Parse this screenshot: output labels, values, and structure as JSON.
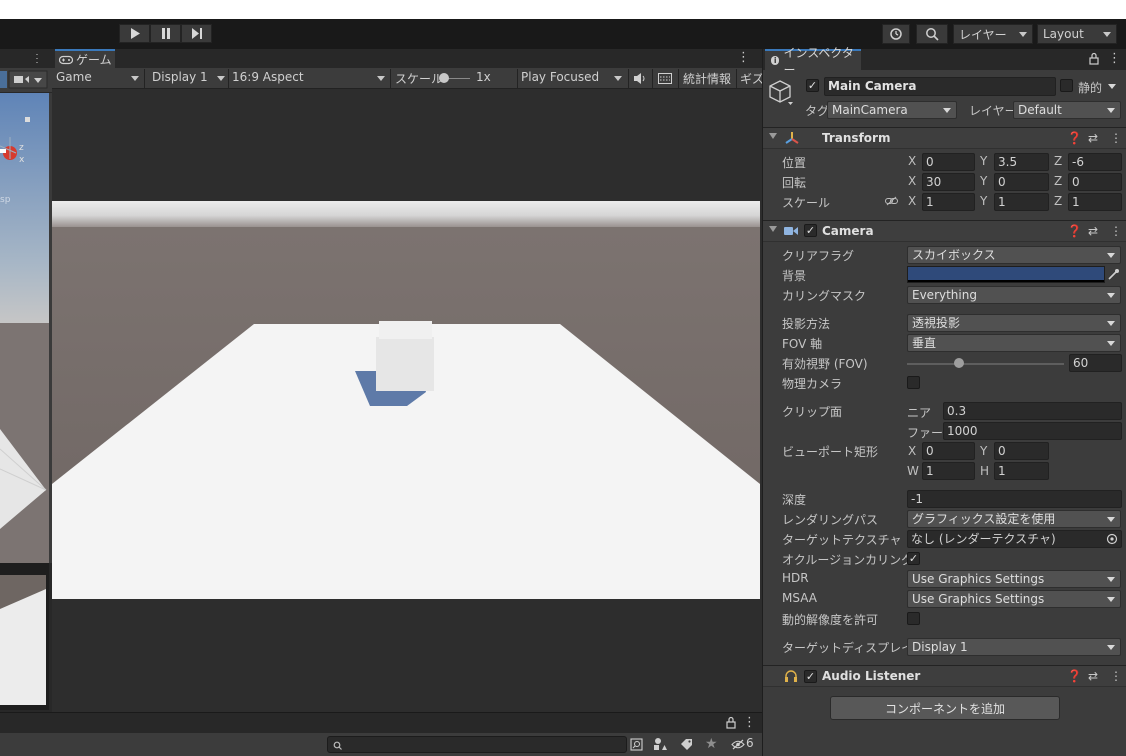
{
  "toolbar": {
    "layers_label": "レイヤー",
    "layout_label": "Layout"
  },
  "game": {
    "tab_label": "ゲーム",
    "view_select": "Game",
    "display_select": "Display 1",
    "aspect_select": "16:9 Aspect",
    "scale_label": "スケール",
    "scale_value": "1x",
    "play_mode_select": "Play Focused",
    "stats_label": "統計情報",
    "gizmos_label": "ギズ"
  },
  "inspector": {
    "tab_label": "インスペクター",
    "object_name": "Main Camera",
    "static_label": "静的",
    "tag_label": "タグ",
    "tag_value": "MainCamera",
    "layer_label": "レイヤー",
    "layer_value": "Default",
    "transform": {
      "title": "Transform",
      "position_label": "位置",
      "rotation_label": "回転",
      "scale_label": "スケール",
      "position": {
        "x": "0",
        "y": "3.5",
        "z": "-6"
      },
      "rotation": {
        "x": "30",
        "y": "0",
        "z": "0"
      },
      "scale": {
        "x": "1",
        "y": "1",
        "z": "1"
      }
    },
    "camera": {
      "title": "Camera",
      "clear_flags_label": "クリアフラグ",
      "clear_flags_value": "スカイボックス",
      "background_label": "背景",
      "background_color": "#2f4a7a",
      "culling_mask_label": "カリングマスク",
      "culling_mask_value": "Everything",
      "projection_label": "投影方法",
      "projection_value": "透視投影",
      "fov_axis_label": "FOV 軸",
      "fov_axis_value": "垂直",
      "fov_label": "有効視野 (FOV)",
      "fov_value": "60",
      "fov_fraction": 0.33,
      "physical_label": "物理カメラ",
      "clip_label": "クリップ面",
      "near_label": "ニア",
      "near_value": "0.3",
      "far_label": "ファー",
      "far_value": "1000",
      "viewport_label": "ビューポート矩形",
      "viewport": {
        "x": "0",
        "y": "0",
        "w": "1",
        "h": "1"
      },
      "depth_label": "深度",
      "depth_value": "-1",
      "render_path_label": "レンダリングパス",
      "render_path_value": "グラフィックス設定を使用",
      "target_texture_label": "ターゲットテクスチャ",
      "target_texture_value": "なし (レンダーテクスチャ)",
      "occlusion_label": "オクルージョンカリング",
      "hdr_label": "HDR",
      "hdr_value": "Use Graphics Settings",
      "msaa_label": "MSAA",
      "msaa_value": "Use Graphics Settings",
      "dynamic_res_label": "動的解像度を許可",
      "target_display_label": "ターゲットディスプレイ",
      "target_display_value": "Display 1"
    },
    "audio_listener": {
      "title": "Audio Listener"
    },
    "add_component_label": "コンポーネントを追加"
  },
  "bottom": {
    "hidden_count": "6"
  }
}
